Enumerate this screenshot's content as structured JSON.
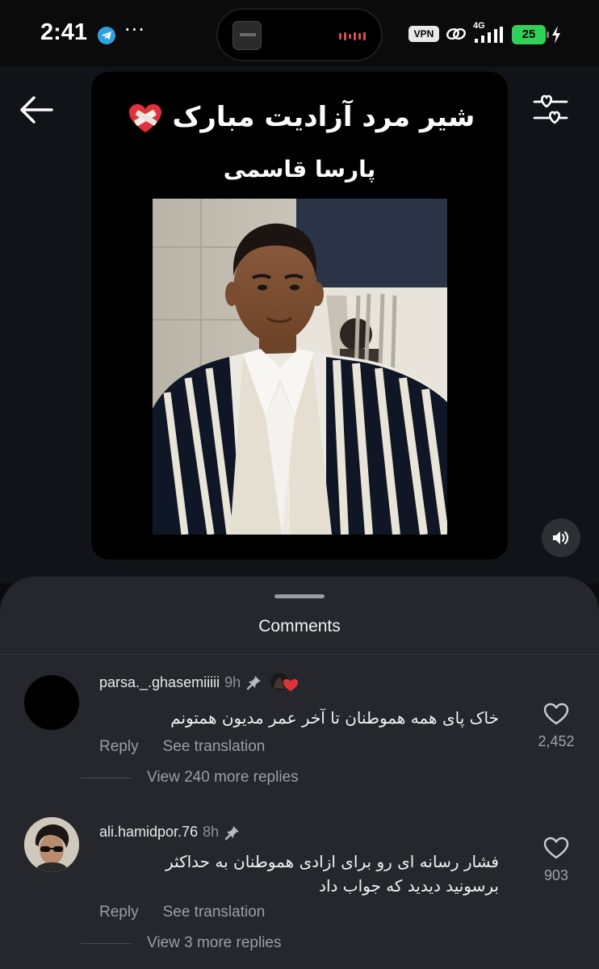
{
  "status_bar": {
    "time": "2:41",
    "more": "···",
    "vpn": "VPN",
    "network": "4G",
    "battery": "25"
  },
  "story": {
    "title": "شیر مرد آزادیت مبارک",
    "name": "پارسا قاسمی"
  },
  "comments_sheet": {
    "title": "Comments",
    "comments": [
      {
        "username": "parsa._.ghasemiiiii",
        "time": "9h",
        "text": "خاک پای همه هموطنان تا آخر عمر مدیون همتونم",
        "reply_label": "Reply",
        "translate_label": "See translation",
        "likes": "2,452",
        "view_replies": "View 240 more replies"
      },
      {
        "username": "ali.hamidpor.76",
        "time": "8h",
        "text_lines": [
          "فشار رسانه ای رو برای ازادی هموطنان به حداکثر",
          "برسونید دیدید که جواب داد"
        ],
        "reply_label": "Reply",
        "translate_label": "See translation",
        "likes": "903",
        "view_replies": "View 3 more replies"
      }
    ]
  },
  "colors": {
    "background": "#0b0c0e",
    "story_bg": "#101418",
    "sheet_bg": "#25272c",
    "muted_text": "#9c9ea4",
    "battery_green": "#30d158",
    "heart_red": "#e0323c"
  },
  "icons": [
    "telegram-icon",
    "link-icon",
    "signal-bars-icon",
    "battery-icon",
    "charging-bolt-icon",
    "back-arrow-icon",
    "heart-filter-icon",
    "volume-icon",
    "pin-icon",
    "heart-outline-icon",
    "mending-heart-emoji"
  ]
}
